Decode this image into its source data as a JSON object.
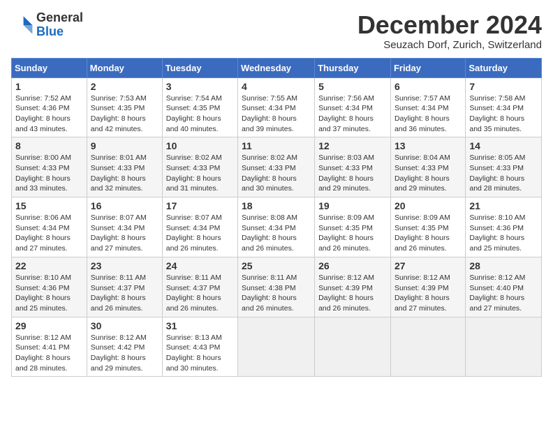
{
  "header": {
    "logo_general": "General",
    "logo_blue": "Blue",
    "month_title": "December 2024",
    "location": "Seuzach Dorf, Zurich, Switzerland"
  },
  "days_of_week": [
    "Sunday",
    "Monday",
    "Tuesday",
    "Wednesday",
    "Thursday",
    "Friday",
    "Saturday"
  ],
  "weeks": [
    [
      {
        "day": "1",
        "sunrise": "7:52 AM",
        "sunset": "4:36 PM",
        "daylight": "8 hours and 43 minutes."
      },
      {
        "day": "2",
        "sunrise": "7:53 AM",
        "sunset": "4:35 PM",
        "daylight": "8 hours and 42 minutes."
      },
      {
        "day": "3",
        "sunrise": "7:54 AM",
        "sunset": "4:35 PM",
        "daylight": "8 hours and 40 minutes."
      },
      {
        "day": "4",
        "sunrise": "7:55 AM",
        "sunset": "4:34 PM",
        "daylight": "8 hours and 39 minutes."
      },
      {
        "day": "5",
        "sunrise": "7:56 AM",
        "sunset": "4:34 PM",
        "daylight": "8 hours and 37 minutes."
      },
      {
        "day": "6",
        "sunrise": "7:57 AM",
        "sunset": "4:34 PM",
        "daylight": "8 hours and 36 minutes."
      },
      {
        "day": "7",
        "sunrise": "7:58 AM",
        "sunset": "4:34 PM",
        "daylight": "8 hours and 35 minutes."
      }
    ],
    [
      {
        "day": "8",
        "sunrise": "8:00 AM",
        "sunset": "4:33 PM",
        "daylight": "8 hours and 33 minutes."
      },
      {
        "day": "9",
        "sunrise": "8:01 AM",
        "sunset": "4:33 PM",
        "daylight": "8 hours and 32 minutes."
      },
      {
        "day": "10",
        "sunrise": "8:02 AM",
        "sunset": "4:33 PM",
        "daylight": "8 hours and 31 minutes."
      },
      {
        "day": "11",
        "sunrise": "8:02 AM",
        "sunset": "4:33 PM",
        "daylight": "8 hours and 30 minutes."
      },
      {
        "day": "12",
        "sunrise": "8:03 AM",
        "sunset": "4:33 PM",
        "daylight": "8 hours and 29 minutes."
      },
      {
        "day": "13",
        "sunrise": "8:04 AM",
        "sunset": "4:33 PM",
        "daylight": "8 hours and 29 minutes."
      },
      {
        "day": "14",
        "sunrise": "8:05 AM",
        "sunset": "4:33 PM",
        "daylight": "8 hours and 28 minutes."
      }
    ],
    [
      {
        "day": "15",
        "sunrise": "8:06 AM",
        "sunset": "4:34 PM",
        "daylight": "8 hours and 27 minutes."
      },
      {
        "day": "16",
        "sunrise": "8:07 AM",
        "sunset": "4:34 PM",
        "daylight": "8 hours and 27 minutes."
      },
      {
        "day": "17",
        "sunrise": "8:07 AM",
        "sunset": "4:34 PM",
        "daylight": "8 hours and 26 minutes."
      },
      {
        "day": "18",
        "sunrise": "8:08 AM",
        "sunset": "4:34 PM",
        "daylight": "8 hours and 26 minutes."
      },
      {
        "day": "19",
        "sunrise": "8:09 AM",
        "sunset": "4:35 PM",
        "daylight": "8 hours and 26 minutes."
      },
      {
        "day": "20",
        "sunrise": "8:09 AM",
        "sunset": "4:35 PM",
        "daylight": "8 hours and 26 minutes."
      },
      {
        "day": "21",
        "sunrise": "8:10 AM",
        "sunset": "4:36 PM",
        "daylight": "8 hours and 25 minutes."
      }
    ],
    [
      {
        "day": "22",
        "sunrise": "8:10 AM",
        "sunset": "4:36 PM",
        "daylight": "8 hours and 25 minutes."
      },
      {
        "day": "23",
        "sunrise": "8:11 AM",
        "sunset": "4:37 PM",
        "daylight": "8 hours and 26 minutes."
      },
      {
        "day": "24",
        "sunrise": "8:11 AM",
        "sunset": "4:37 PM",
        "daylight": "8 hours and 26 minutes."
      },
      {
        "day": "25",
        "sunrise": "8:11 AM",
        "sunset": "4:38 PM",
        "daylight": "8 hours and 26 minutes."
      },
      {
        "day": "26",
        "sunrise": "8:12 AM",
        "sunset": "4:39 PM",
        "daylight": "8 hours and 26 minutes."
      },
      {
        "day": "27",
        "sunrise": "8:12 AM",
        "sunset": "4:39 PM",
        "daylight": "8 hours and 27 minutes."
      },
      {
        "day": "28",
        "sunrise": "8:12 AM",
        "sunset": "4:40 PM",
        "daylight": "8 hours and 27 minutes."
      }
    ],
    [
      {
        "day": "29",
        "sunrise": "8:12 AM",
        "sunset": "4:41 PM",
        "daylight": "8 hours and 28 minutes."
      },
      {
        "day": "30",
        "sunrise": "8:12 AM",
        "sunset": "4:42 PM",
        "daylight": "8 hours and 29 minutes."
      },
      {
        "day": "31",
        "sunrise": "8:13 AM",
        "sunset": "4:43 PM",
        "daylight": "8 hours and 30 minutes."
      },
      null,
      null,
      null,
      null
    ]
  ]
}
